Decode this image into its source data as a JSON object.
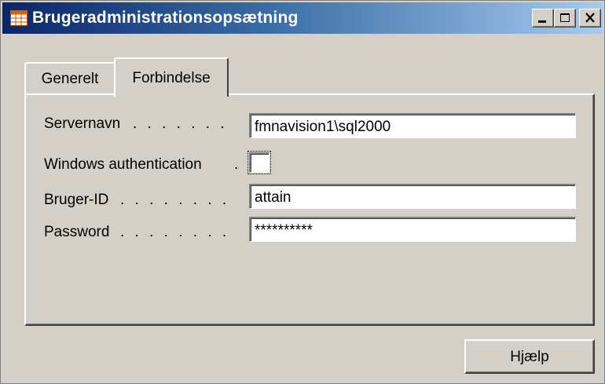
{
  "window": {
    "title": "Brugeradministrationsopsætning",
    "icon": "table-icon"
  },
  "titlebar_buttons": {
    "minimize": "minimize-icon",
    "maximize": "maximize-icon",
    "close": "close-icon"
  },
  "tabs": [
    {
      "label": "Generelt",
      "active": false
    },
    {
      "label": "Forbindelse",
      "active": true
    }
  ],
  "form": {
    "server_name": {
      "label": "Servernavn",
      "dots": ". . . . . . .",
      "value": "fmnavision1\\sql2000"
    },
    "windows_auth": {
      "label": "Windows authentication",
      "dots": ".",
      "checked": false
    },
    "user_id": {
      "label": "Bruger-ID",
      "dots": ". . . . . . . .",
      "value": "attain"
    },
    "password": {
      "label": "Password",
      "dots": ". . . . . . . .",
      "value": "**********"
    }
  },
  "buttons": {
    "help": "Hjælp"
  }
}
